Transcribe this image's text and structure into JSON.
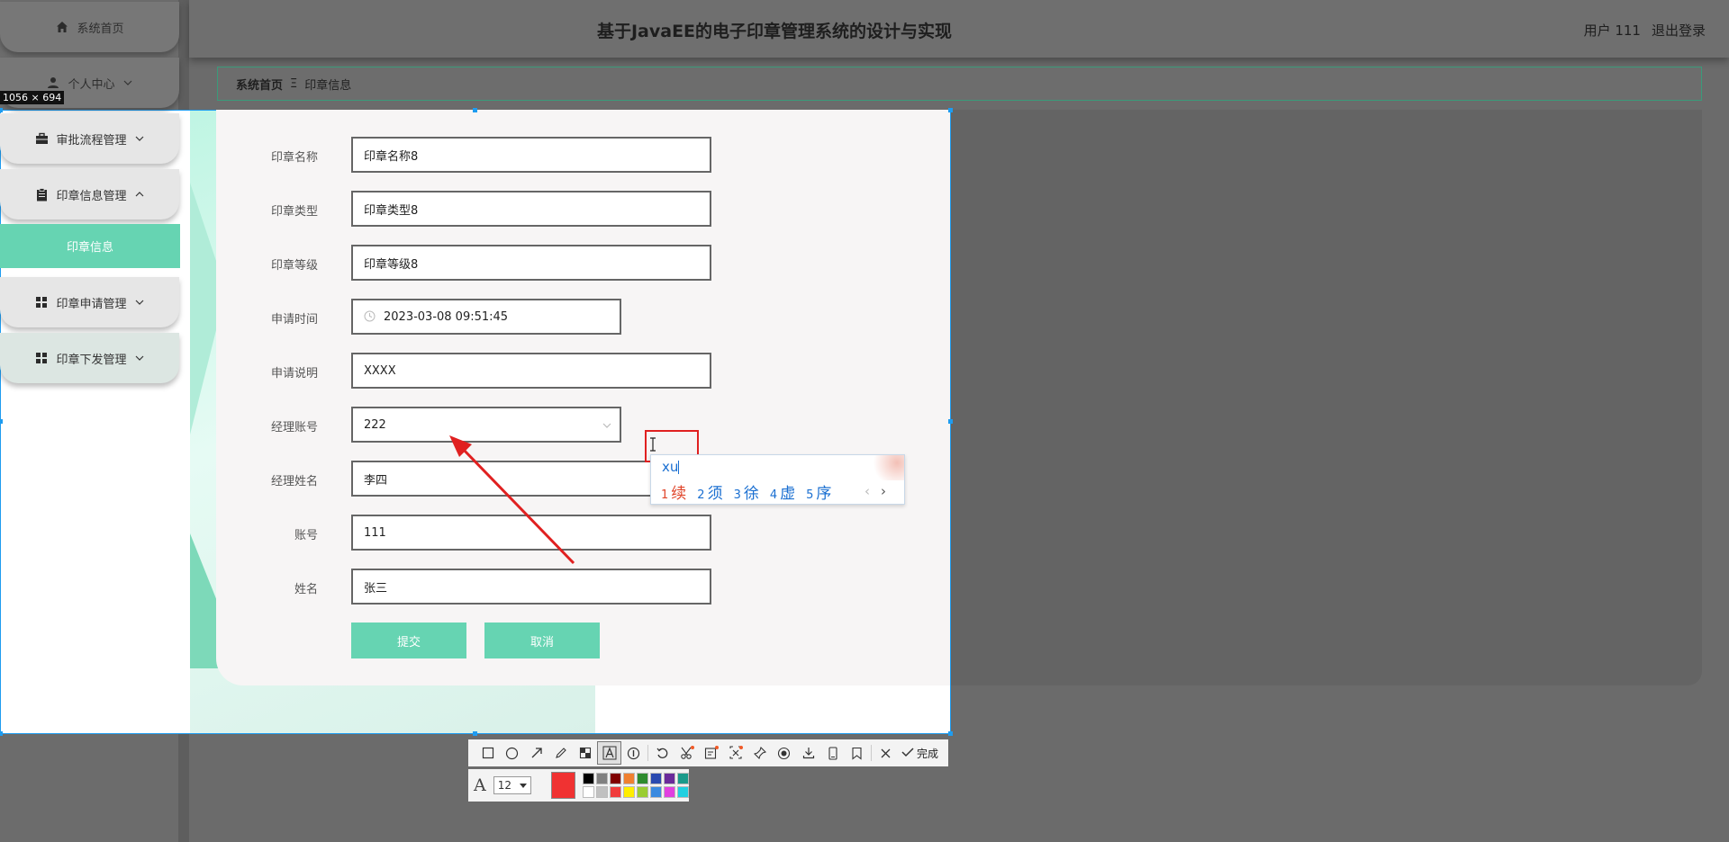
{
  "app": {
    "title": "基于JavaEE的电子印章管理系统的设计与实现",
    "user_label": "用户 111",
    "logout_label": "退出登录"
  },
  "sidebar": {
    "items": [
      {
        "label": "系统首页",
        "icon": "home-icon"
      },
      {
        "label": "个人中心",
        "icon": "person-icon"
      },
      {
        "label": "审批流程管理",
        "icon": "briefcase-icon"
      },
      {
        "label": "印章信息管理",
        "icon": "clipboard-icon"
      },
      {
        "label": "印章申请管理",
        "icon": "grid-icon"
      },
      {
        "label": "印章下发管理",
        "icon": "grid-icon"
      }
    ],
    "active_sub": "印章信息"
  },
  "breadcrumb": {
    "home": "系统首页",
    "separator": "Ξ",
    "current": "印章信息"
  },
  "selection": {
    "size_label": "1056 × 694"
  },
  "form": {
    "fields": [
      {
        "label": "印章名称",
        "value": "印章名称8"
      },
      {
        "label": "印章类型",
        "value": "印章类型8"
      },
      {
        "label": "印章等级",
        "value": "印章等级8"
      },
      {
        "label": "申请时间",
        "value": "2023-03-08 09:51:45"
      },
      {
        "label": "申请说明",
        "value": "XXXX"
      },
      {
        "label": "经理账号",
        "value": "222"
      },
      {
        "label": "经理姓名",
        "value": "李四"
      },
      {
        "label": "账号",
        "value": "111"
      },
      {
        "label": "姓名",
        "value": "张三"
      }
    ],
    "submit_label": "提交",
    "cancel_label": "取消"
  },
  "ime": {
    "composition": "xu",
    "candidates": [
      {
        "num": "1",
        "char": "续"
      },
      {
        "num": "2",
        "char": "须"
      },
      {
        "num": "3",
        "char": "徐"
      },
      {
        "num": "4",
        "char": "虚"
      },
      {
        "num": "5",
        "char": "序"
      }
    ],
    "prev": "‹",
    "next": "›"
  },
  "snip_toolbar": {
    "done_label": "完成",
    "font_size": "12",
    "current_color": "#f03232",
    "palette": [
      "#000000",
      "#808080",
      "#800000",
      "#f08030",
      "#2e8b2e",
      "#2a4ab0",
      "#6a2a9a",
      "#1a9a8a",
      "#ffffff",
      "#c0c0c0",
      "#f03c3c",
      "#ffee00",
      "#9acd32",
      "#3a8ae0",
      "#e040e0",
      "#20d0e0"
    ]
  },
  "colors": {
    "accent": "#66d4b2",
    "selection_border": "#1e9cf0",
    "annotation_red": "#e02020",
    "ime_blue": "#1a6fd1"
  }
}
